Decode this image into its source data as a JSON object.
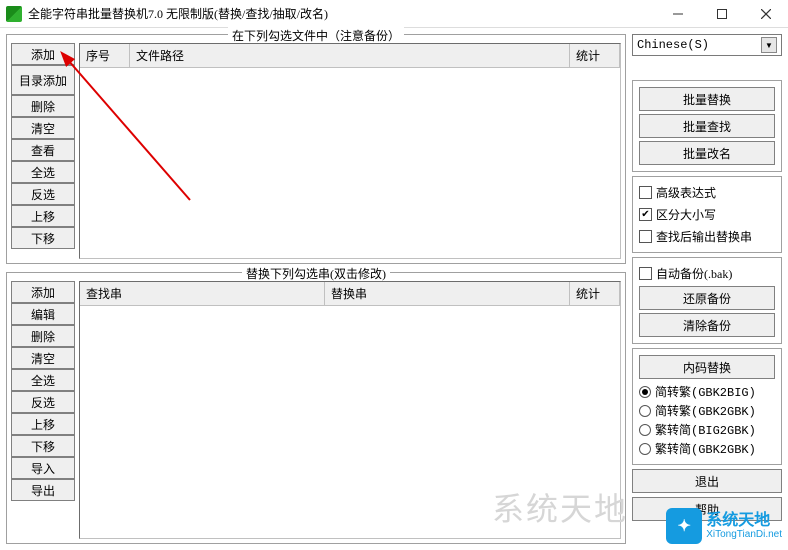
{
  "window": {
    "title": "全能字符串批量替换机7.0 无限制版(替换/查找/抽取/改名)"
  },
  "top_panel": {
    "title": "在下列勾选文件中（注意备份）",
    "buttons": [
      "添加",
      "目录添加",
      "删除",
      "清空",
      "查看",
      "全选",
      "反选",
      "上移",
      "下移"
    ],
    "columns": {
      "num": "序号",
      "path": "文件路径",
      "stat": "统计"
    }
  },
  "bottom_panel": {
    "title": "替换下列勾选串(双击修改)",
    "buttons": [
      "添加",
      "编辑",
      "删除",
      "清空",
      "全选",
      "反选",
      "上移",
      "下移",
      "导入",
      "导出"
    ],
    "columns": {
      "find": "查找串",
      "replace": "替换串",
      "stat": "统计"
    }
  },
  "right": {
    "language": "Chinese(S)",
    "batch_buttons": [
      "批量替换",
      "批量查找",
      "批量改名"
    ],
    "options": {
      "advanced": {
        "label": "高级表达式",
        "checked": false
      },
      "case_sensitive": {
        "label": "区分大小写",
        "checked": true
      },
      "output_after_search": {
        "label": "查找后输出替换串",
        "checked": false
      }
    },
    "backup": {
      "auto_backup": {
        "label": "自动备份(.bak)",
        "checked": false
      },
      "restore": "还原备份",
      "clear": "清除备份"
    },
    "encoding": {
      "title": "内码替换",
      "options": [
        {
          "label": "简转繁(GBK2BIG)",
          "selected": true
        },
        {
          "label": "简转繁(GBK2GBK)",
          "selected": false
        },
        {
          "label": "繁转简(BIG2GBK)",
          "selected": false
        },
        {
          "label": "繁转简(GBK2GBK)",
          "selected": false
        }
      ]
    },
    "exit": "退出",
    "help": "帮助"
  },
  "watermark": {
    "cn": "系统天地",
    "url": "XiTongTianDi.net"
  }
}
